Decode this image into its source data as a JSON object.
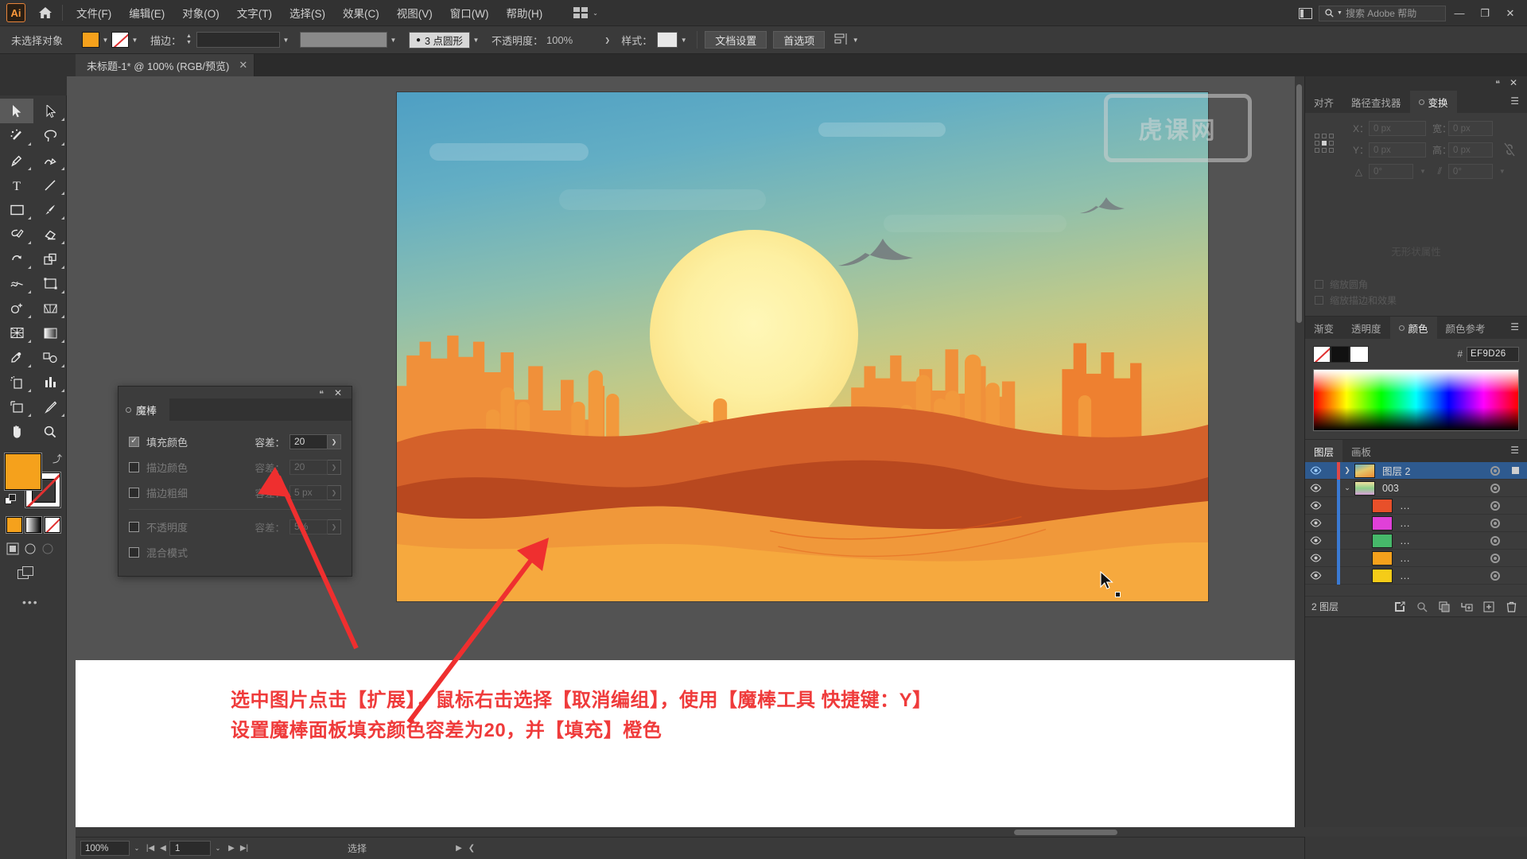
{
  "app": {
    "logo": "Ai",
    "home_icon": "home-icon"
  },
  "menubar": {
    "items": [
      {
        "label": "文件(F)"
      },
      {
        "label": "编辑(E)"
      },
      {
        "label": "对象(O)"
      },
      {
        "label": "文字(T)"
      },
      {
        "label": "选择(S)"
      },
      {
        "label": "效果(C)"
      },
      {
        "label": "视图(V)"
      },
      {
        "label": "窗口(W)"
      },
      {
        "label": "帮助(H)"
      }
    ],
    "workspace_caret": "⌄",
    "search_placeholder": "搜索 Adobe 帮助",
    "search_icon": "search-icon",
    "window_buttons": [
      "—",
      "❐",
      "✕"
    ]
  },
  "controlbar": {
    "selection_status": "未选择对象",
    "fill_color": "#f5a11c",
    "stroke_label": "描边：",
    "stroke_weight": "",
    "stroke_profile": "",
    "brush_def": "",
    "shape_label": "3 点圆形",
    "opacity_label": "不透明度：",
    "opacity_value": "100%",
    "opacity_arrow": "❯",
    "style_label": "样式：",
    "doc_setup_button": "文档设置",
    "preferences_button": "首选项",
    "align_icon": "align-icon"
  },
  "document_tab": {
    "title": "未标题-1* @ 100% (RGB/预览)",
    "close": "✕"
  },
  "toolbar": {
    "tools": [
      {
        "name": "selection-tool",
        "active": true
      },
      {
        "name": "direct-selection-tool",
        "active": false
      },
      {
        "name": "magic-wand-tool",
        "active": false
      },
      {
        "name": "lasso-tool",
        "active": false
      },
      {
        "name": "pen-tool",
        "active": false
      },
      {
        "name": "curvature-tool",
        "active": false
      },
      {
        "name": "type-tool",
        "active": false
      },
      {
        "name": "line-segment-tool",
        "active": false
      },
      {
        "name": "rectangle-tool",
        "active": false
      },
      {
        "name": "paintbrush-tool",
        "active": false
      },
      {
        "name": "shaper-tool",
        "active": false
      },
      {
        "name": "eraser-tool",
        "active": false
      },
      {
        "name": "rotate-tool",
        "active": false
      },
      {
        "name": "scale-tool",
        "active": false
      },
      {
        "name": "width-tool",
        "active": false
      },
      {
        "name": "free-transform-tool",
        "active": false
      },
      {
        "name": "shape-builder-tool",
        "active": false
      },
      {
        "name": "perspective-grid-tool",
        "active": false
      },
      {
        "name": "mesh-tool",
        "active": false
      },
      {
        "name": "gradient-tool",
        "active": false
      },
      {
        "name": "eyedropper-tool",
        "active": false
      },
      {
        "name": "blend-tool",
        "active": false
      },
      {
        "name": "symbol-sprayer-tool",
        "active": false
      },
      {
        "name": "column-graph-tool",
        "active": false
      },
      {
        "name": "artboard-tool",
        "active": false
      },
      {
        "name": "slice-tool",
        "active": false
      },
      {
        "name": "hand-tool",
        "active": false
      },
      {
        "name": "zoom-tool",
        "active": false
      }
    ],
    "fill_color": "#f5a11c",
    "stroke_color": "#ffffff",
    "more_dots": "•••"
  },
  "magic_wand_panel": {
    "tab_title": "魔棒",
    "close": "✕",
    "dots": "❝",
    "menu": "❯",
    "rows": [
      {
        "label": "填充颜色",
        "checked": true,
        "tolerance_label": "容差：",
        "tolerance_value": "20",
        "disabled": false
      },
      {
        "label": "描边颜色",
        "checked": false,
        "tolerance_label": "容差：",
        "tolerance_value": "20",
        "disabled": true
      },
      {
        "label": "描边粗细",
        "checked": false,
        "tolerance_label": "容差：",
        "tolerance_value": "5 px",
        "disabled": true
      },
      {
        "label": "不透明度",
        "checked": false,
        "tolerance_label": "容差：",
        "tolerance_value": "5%",
        "disabled": true
      },
      {
        "label": "混合模式",
        "checked": false,
        "tolerance_label": "",
        "tolerance_value": "",
        "disabled": true
      }
    ]
  },
  "right_dock": {
    "transform_group": {
      "tabs": [
        {
          "label": "对齐",
          "active": false
        },
        {
          "label": "路径查找器",
          "active": false
        },
        {
          "label": "变换",
          "active": true
        }
      ],
      "menu_icon": "panel-menu-icon",
      "fields": {
        "x_label": "X：",
        "x_value": "0 px",
        "y_label": "Y：",
        "y_value": "0 px",
        "w_label": "宽：",
        "w_value": "0 px",
        "h_label": "高：",
        "h_value": "0 px",
        "angle_label": "△",
        "angle_value": "0°",
        "shear_label": "⫽",
        "shear_value": "0°"
      },
      "link_icon": "link-broken-icon",
      "no_properties": "无形状属性",
      "appearance_options": [
        {
          "label": "缩放圆角"
        },
        {
          "label": "缩放描边和效果"
        }
      ]
    },
    "color_group": {
      "tabs": [
        {
          "label": "渐变",
          "active": false
        },
        {
          "label": "透明度",
          "active": false
        },
        {
          "label": "颜色",
          "active": true
        },
        {
          "label": "颜色参考",
          "active": false
        }
      ],
      "menu_icon": "panel-menu-icon",
      "hash": "#",
      "hex_value": "EF9D26",
      "swatch_none": "none-swatch",
      "swatch_black": "#000000",
      "swatch_white": "#ffffff"
    },
    "layers_group": {
      "tabs": [
        {
          "label": "图层",
          "active": true
        },
        {
          "label": "画板",
          "active": false
        }
      ],
      "menu_icon": "panel-menu-icon",
      "rows": [
        {
          "name": "图层 2",
          "selected": true,
          "indent": 0,
          "thumb": "#e8903a",
          "expand": "❯",
          "eye": true
        },
        {
          "name": "003",
          "selected": false,
          "indent": 1,
          "thumb": "#dddddd",
          "expand": "⌄",
          "eye": true
        },
        {
          "name": "…",
          "selected": false,
          "indent": 2,
          "thumb": "#e8502a",
          "expand": "",
          "eye": true
        },
        {
          "name": "…",
          "selected": false,
          "indent": 2,
          "thumb": "#e040d8",
          "expand": "",
          "eye": true
        },
        {
          "name": "…",
          "selected": false,
          "indent": 2,
          "thumb": "#46b86a",
          "expand": "",
          "eye": true
        },
        {
          "name": "…",
          "selected": false,
          "indent": 2,
          "thumb": "#f5a11c",
          "expand": "",
          "eye": true
        },
        {
          "name": "…",
          "selected": false,
          "indent": 2,
          "thumb": "#f5cc18",
          "expand": "",
          "eye": true
        }
      ],
      "footer_count": "2 图层",
      "footer_icons": [
        {
          "name": "locate-object-icon"
        },
        {
          "name": "release-to-layers-icon"
        },
        {
          "name": "make-clipping-mask-icon"
        },
        {
          "name": "create-new-sublayer-icon"
        },
        {
          "name": "create-new-layer-icon"
        },
        {
          "name": "delete-selection-icon"
        }
      ]
    }
  },
  "canvas": {
    "artwork_alt": "desert-sunset-illustration",
    "cursor": "arrow-cursor"
  },
  "annotation": {
    "line1": "选中图片点击【扩展】，鼠标右击选择【取消编组】，使用【魔棒工具 快捷键：Y】",
    "line2": "设置魔棒面板填充颜色容差为20，并【填充】橙色",
    "color": "#ef3b3b"
  },
  "statusbar": {
    "zoom_value": "100%",
    "zoom_caret": "⌄",
    "first_icon": "|◀",
    "prev_icon": "◀",
    "page_value": "1",
    "page_caret": "⌄",
    "next_icon": "▶",
    "last_icon": "▶|",
    "info_text": "选择",
    "info_caret": "▶",
    "info_caret2": "❮"
  },
  "watermark": {
    "text": "虎课网"
  }
}
